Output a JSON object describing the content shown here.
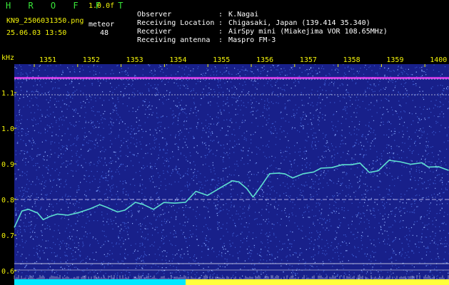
{
  "app": {
    "title": "H R O F F T",
    "version": "1.0.0f",
    "filename": "KN9_2506031350.png",
    "meteor_label": "meteor",
    "datetime": "25.06.03 13:50",
    "meteor_count": "48"
  },
  "info": [
    {
      "key": "Observer",
      "value": "K.Nagai"
    },
    {
      "key": "Receiving Location",
      "value": "Chigasaki, Japan (139.414 35.340)"
    },
    {
      "key": "Receiver",
      "value": "AirSpy mini (Miakejima VOR 108.65MHz)"
    },
    {
      "key": "Receiving antenna",
      "value": "Maspro FM-3"
    }
  ],
  "info_separator": ":",
  "axis": {
    "y_unit": "kHz",
    "y_ticks": [
      "1.1",
      "1.0",
      "0.9",
      "0.8",
      "0.7",
      "0.6"
    ],
    "x_ticks": [
      "1351",
      "1352",
      "1353",
      "1354",
      "1355",
      "1356",
      "1357",
      "1358",
      "1359",
      "1400"
    ]
  },
  "colors": {
    "background": "#000000",
    "noise_base": "#18208a",
    "echo_line": "#5fe0d0",
    "axis_label": "#f4f40a",
    "cyan_band": "#00e8ff",
    "yellow_band": "#ffff3a",
    "magenta_line": "#ff40ff"
  }
}
